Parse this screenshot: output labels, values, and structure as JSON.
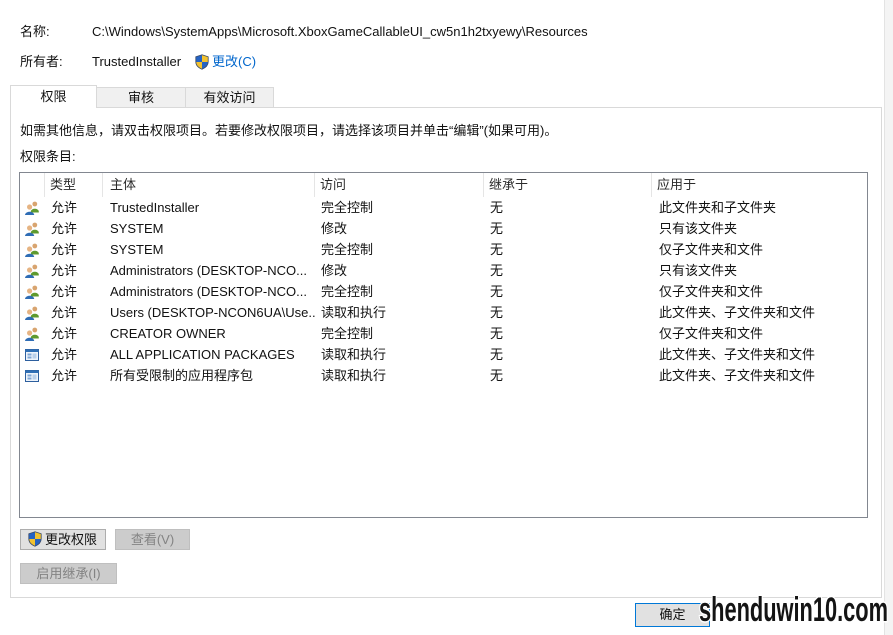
{
  "dialog": {
    "name_label": "名称:",
    "name_value": "C:\\Windows\\SystemApps\\Microsoft.XboxGameCallableUI_cw5n1h2txyewy\\Resources",
    "owner_label": "所有者:",
    "owner_value": "TrustedInstaller",
    "change_owner_link": "更改(C)"
  },
  "tabs": [
    {
      "label": "权限",
      "active": true
    },
    {
      "label": "审核",
      "active": false
    },
    {
      "label": "有效访问",
      "active": false
    }
  ],
  "permissions": {
    "info_text": "如需其他信息，请双击权限项目。若要修改权限项目，请选择该项目并单击“编辑”(如果可用)。",
    "entries_label": "权限条目:",
    "columns": [
      "类型",
      "主体",
      "访问",
      "继承于",
      "应用于"
    ],
    "rows": [
      {
        "icon": "user-group-icon",
        "type": "允许",
        "principal": "TrustedInstaller",
        "access": "完全控制",
        "inherited_from": "无",
        "applies_to": "此文件夹和子文件夹"
      },
      {
        "icon": "user-group-icon",
        "type": "允许",
        "principal": "SYSTEM",
        "access": "修改",
        "inherited_from": "无",
        "applies_to": "只有该文件夹"
      },
      {
        "icon": "user-group-icon",
        "type": "允许",
        "principal": "SYSTEM",
        "access": "完全控制",
        "inherited_from": "无",
        "applies_to": "仅子文件夹和文件"
      },
      {
        "icon": "user-group-icon",
        "type": "允许",
        "principal": "Administrators (DESKTOP-NCO...",
        "access": "修改",
        "inherited_from": "无",
        "applies_to": "只有该文件夹"
      },
      {
        "icon": "user-group-icon",
        "type": "允许",
        "principal": "Administrators (DESKTOP-NCO...",
        "access": "完全控制",
        "inherited_from": "无",
        "applies_to": "仅子文件夹和文件"
      },
      {
        "icon": "user-group-icon",
        "type": "允许",
        "principal": "Users (DESKTOP-NCON6UA\\Use...",
        "access": "读取和执行",
        "inherited_from": "无",
        "applies_to": "此文件夹、子文件夹和文件"
      },
      {
        "icon": "user-group-icon",
        "type": "允许",
        "principal": "CREATOR OWNER",
        "access": "完全控制",
        "inherited_from": "无",
        "applies_to": "仅子文件夹和文件"
      },
      {
        "icon": "app-package-icon",
        "type": "允许",
        "principal": "ALL APPLICATION PACKAGES",
        "access": "读取和执行",
        "inherited_from": "无",
        "applies_to": "此文件夹、子文件夹和文件"
      },
      {
        "icon": "app-package-icon",
        "type": "允许",
        "principal": "所有受限制的应用程序包",
        "access": "读取和执行",
        "inherited_from": "无",
        "applies_to": "此文件夹、子文件夹和文件"
      }
    ]
  },
  "buttons": {
    "change_permissions": "更改权限",
    "view": "查看(V)",
    "enable_inheritance": "启用继承(I)",
    "ok": "确定"
  },
  "button_states": {
    "change_permissions_enabled": true,
    "view_enabled": false,
    "enable_inheritance_enabled": false
  },
  "watermark": "shenduwin10.com",
  "colors": {
    "link": "#0066cc",
    "ok_button_border": "#0078d7",
    "shield_blue": "#2563c4",
    "shield_yellow": "#f2c230"
  }
}
